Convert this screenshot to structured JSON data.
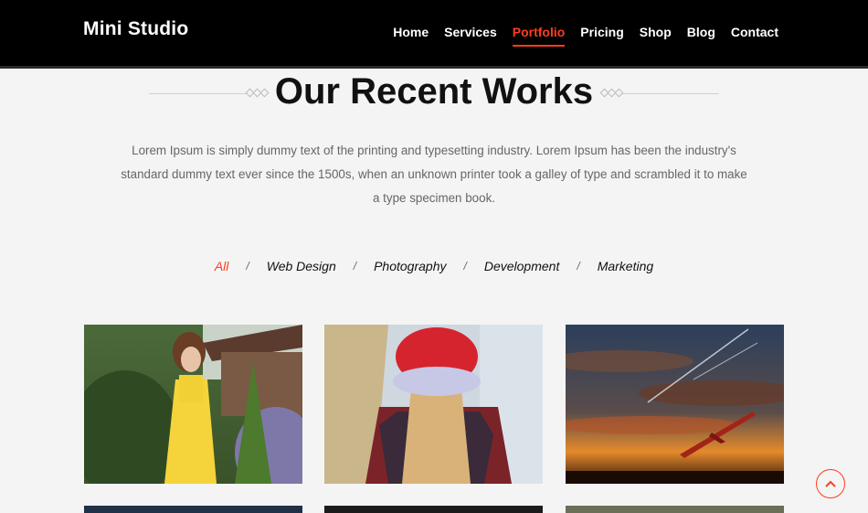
{
  "header": {
    "logo": "Mini Studio",
    "nav": [
      "Home",
      "Services",
      "Portfolio",
      "Pricing",
      "Shop",
      "Blog",
      "Contact"
    ],
    "active_index": 2
  },
  "section": {
    "title": "Our Recent Works",
    "intro": "Lorem Ipsum is simply dummy text of the printing and typesetting industry. Lorem Ipsum has been the industry's standard dummy text ever since the 1500s, when an unknown printer took a galley of type and scrambled it to make a type specimen book."
  },
  "filters": {
    "items": [
      "All",
      "Web Design",
      "Photography",
      "Development",
      "Marketing"
    ],
    "separator": "/",
    "active_index": 0
  },
  "portfolio": {
    "items": [
      {
        "subject": "woman in yellow dress in garden"
      },
      {
        "subject": "girl with red cap"
      },
      {
        "subject": "glider at sunset sky"
      }
    ]
  },
  "colors": {
    "accent": "#ff3c1f",
    "header_bg": "#000000",
    "page_bg": "#f4f4f4"
  },
  "icons": {
    "scroll_top": "chevron-up-icon"
  }
}
